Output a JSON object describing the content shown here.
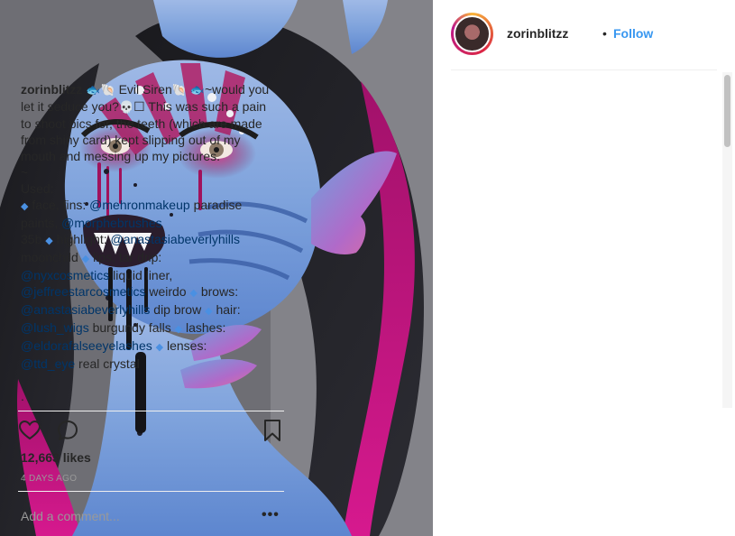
{
  "post": {
    "username": "zorinblitzz",
    "follow_label": "Follow",
    "separator": "•"
  },
  "caption": {
    "author": "zorinblitzz",
    "emoji_fish": "🐟",
    "emoji_shell": "🐚",
    "emoji_skull": "💀",
    "emoji_box": "☐",
    "gem": "◆",
    "t_title": "Evil Siren",
    "t_would": "~would you let it seduce you?",
    "t_pain": "This was such a pain to shoot pics for, the teeth (which are made from shiny card) kept slipping out of my mouth and messing up my pictures.",
    "t_tilde": "~",
    "t_used": "Used:",
    "t_face": "face, fins:",
    "m_mehron": "@mehronmakeup",
    "t_paradise": "paradise paints,",
    "m_morphe": "@morphebrushes",
    "t_35b": "35b",
    "t_highlight": "highlight:",
    "m_anastasia1": "@anastasiabeverlyhills",
    "t_moonchild": "moonchild",
    "t_lips": "lips, tar drip:",
    "m_nyx": "@nyxcosmetics",
    "t_liquid": "liquid liner,",
    "m_jeffree": "@jeffreestarcosmetics",
    "t_weirdo": "weirdo",
    "t_brows": "brows:",
    "m_anastasia2": "@anastasiabeverlyhills",
    "t_dipbrow": "dip brow",
    "t_hair": "hair:",
    "m_lush": "@lush_wigs",
    "t_burgundy": "burgundy falls",
    "t_lashes": "lashes:",
    "m_eldora": "@eldorafalseeyelashes",
    "t_lenses": "lenses:",
    "m_ttd": "@ttd_eye",
    "t_crystal": "real crystal",
    "t_dot1": ".",
    "t_dot2": "."
  },
  "stats": {
    "likes": "12,663 likes",
    "time_ago": "4 DAYS AGO"
  },
  "comment": {
    "placeholder": "Add a comment...",
    "more": "•••"
  },
  "icons": {
    "like": "heart-outline-icon",
    "comment": "speech-bubble-icon",
    "save": "bookmark-icon"
  }
}
